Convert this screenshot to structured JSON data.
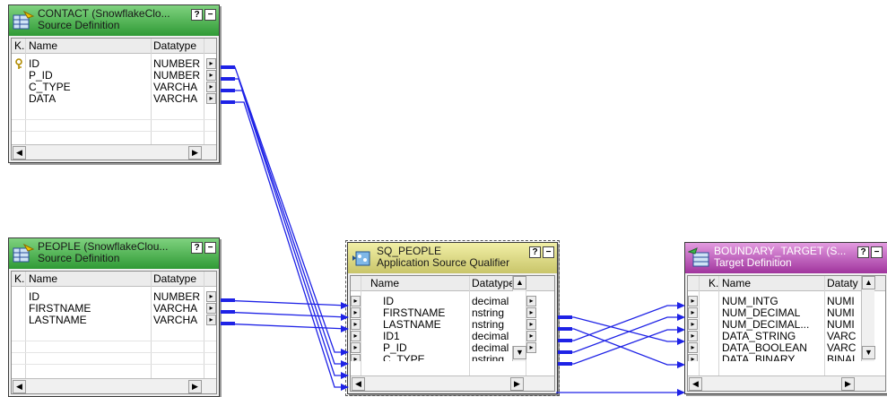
{
  "contact": {
    "title": "CONTACT (SnowflakeClo...",
    "subtitle": "Source Definition",
    "col_key": "K.",
    "col_name": "Name",
    "col_type": "Datatype",
    "rows": [
      {
        "key": true,
        "name": "ID",
        "type": "NUMBER"
      },
      {
        "key": false,
        "name": "P_ID",
        "type": "NUMBER"
      },
      {
        "key": false,
        "name": "C_TYPE",
        "type": "VARCHA"
      },
      {
        "key": false,
        "name": "DATA",
        "type": "VARCHA"
      }
    ]
  },
  "people": {
    "title": "PEOPLE (SnowflakeClou...",
    "subtitle": "Source Definition",
    "col_key": "K.",
    "col_name": "Name",
    "col_type": "Datatype",
    "rows": [
      {
        "name": "ID",
        "type": "NUMBER"
      },
      {
        "name": "FIRSTNAME",
        "type": "VARCHA"
      },
      {
        "name": "LASTNAME",
        "type": "VARCHA"
      }
    ]
  },
  "sq": {
    "title": "SQ_PEOPLE",
    "subtitle": "Application Source Qualifier",
    "col_name": "Name",
    "col_type": "Datatype",
    "rows": [
      {
        "name": "ID",
        "type": "decimal"
      },
      {
        "name": "FIRSTNAME",
        "type": "nstring"
      },
      {
        "name": "LASTNAME",
        "type": "nstring"
      },
      {
        "name": "ID1",
        "type": "decimal"
      },
      {
        "name": "P_ID",
        "type": "decimal"
      },
      {
        "name": "C_TYPE",
        "type": "nstring"
      }
    ]
  },
  "target": {
    "title": "BOUNDARY_TARGET (S...",
    "subtitle": "Target Definition",
    "col_key": "K.",
    "col_name": "Name",
    "col_type": "Dataty",
    "rows": [
      {
        "name": "NUM_INTG",
        "type": "NUMI"
      },
      {
        "name": "NUM_DECIMAL",
        "type": "NUMI"
      },
      {
        "name": "NUM_DECIMAL...",
        "type": "NUMI"
      },
      {
        "name": "DATA_STRING",
        "type": "VARC"
      },
      {
        "name": "DATA_BOOLEAN",
        "type": "VARC"
      },
      {
        "name": "DATA_BINARY",
        "type": "BINAI"
      }
    ]
  },
  "buttons": {
    "help": "?",
    "minimize": "−"
  },
  "colors": {
    "link": "#1e22e6",
    "source_header": "#2f9a35",
    "sq_header": "#c9c56a",
    "target_header": "#a0349d"
  },
  "icons": {
    "source": "source-table-icon",
    "sq": "source-qualifier-icon",
    "target": "target-table-icon",
    "key": "key-icon"
  }
}
